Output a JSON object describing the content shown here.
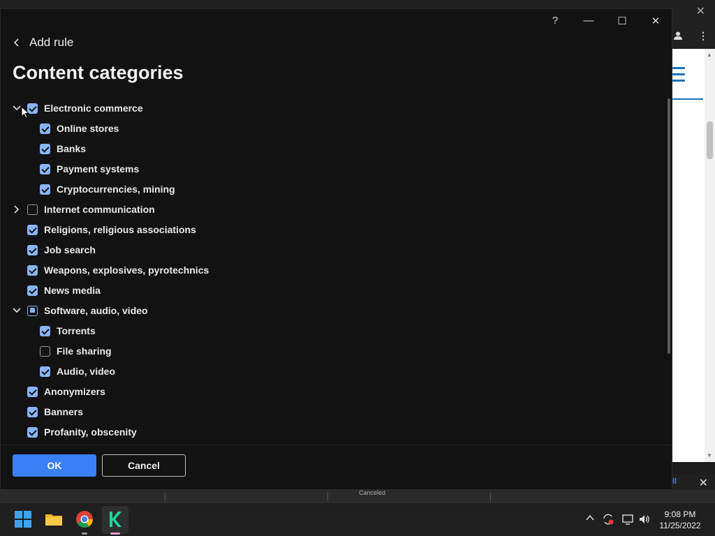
{
  "window": {
    "help_label": "?",
    "minimize_label": "—",
    "maximize_label": "☐",
    "close_label": "✕"
  },
  "header": {
    "back_label": "Add rule",
    "title": "Content categories"
  },
  "categories": [
    {
      "label": "Electronic commerce",
      "state": "checked",
      "level": 0,
      "expander": "expanded"
    },
    {
      "label": "Online stores",
      "state": "checked",
      "level": 1
    },
    {
      "label": "Banks",
      "state": "checked",
      "level": 1
    },
    {
      "label": "Payment systems",
      "state": "checked",
      "level": 1
    },
    {
      "label": "Cryptocurrencies, mining",
      "state": "checked",
      "level": 1
    },
    {
      "label": "Internet communication",
      "state": "unchecked",
      "level": 0,
      "expander": "collapsed"
    },
    {
      "label": "Religions, religious associations",
      "state": "checked",
      "level": 0
    },
    {
      "label": "Job search",
      "state": "checked",
      "level": 0
    },
    {
      "label": "Weapons, explosives, pyrotechnics",
      "state": "checked",
      "level": 0
    },
    {
      "label": "News media",
      "state": "checked",
      "level": 0
    },
    {
      "label": "Software, audio, video",
      "state": "partial",
      "level": 0,
      "expander": "expanded"
    },
    {
      "label": "Torrents",
      "state": "checked",
      "level": 1
    },
    {
      "label": "File sharing",
      "state": "unchecked",
      "level": 1
    },
    {
      "label": "Audio, video",
      "state": "checked",
      "level": 1
    },
    {
      "label": "Anonymizers",
      "state": "checked",
      "level": 0
    },
    {
      "label": "Banners",
      "state": "checked",
      "level": 0
    },
    {
      "label": "Profanity, obscenity",
      "state": "checked",
      "level": 0
    }
  ],
  "footer": {
    "ok_label": "OK",
    "cancel_label": "Cancel"
  },
  "background": {
    "status_text": "Canceled"
  },
  "taskbar": {
    "time": "9:08 PM",
    "date": "11/25/2022"
  },
  "colors": {
    "accent": "#3b7ff5",
    "checkbox": "#8ab4f8",
    "dialog_bg": "#121212"
  }
}
